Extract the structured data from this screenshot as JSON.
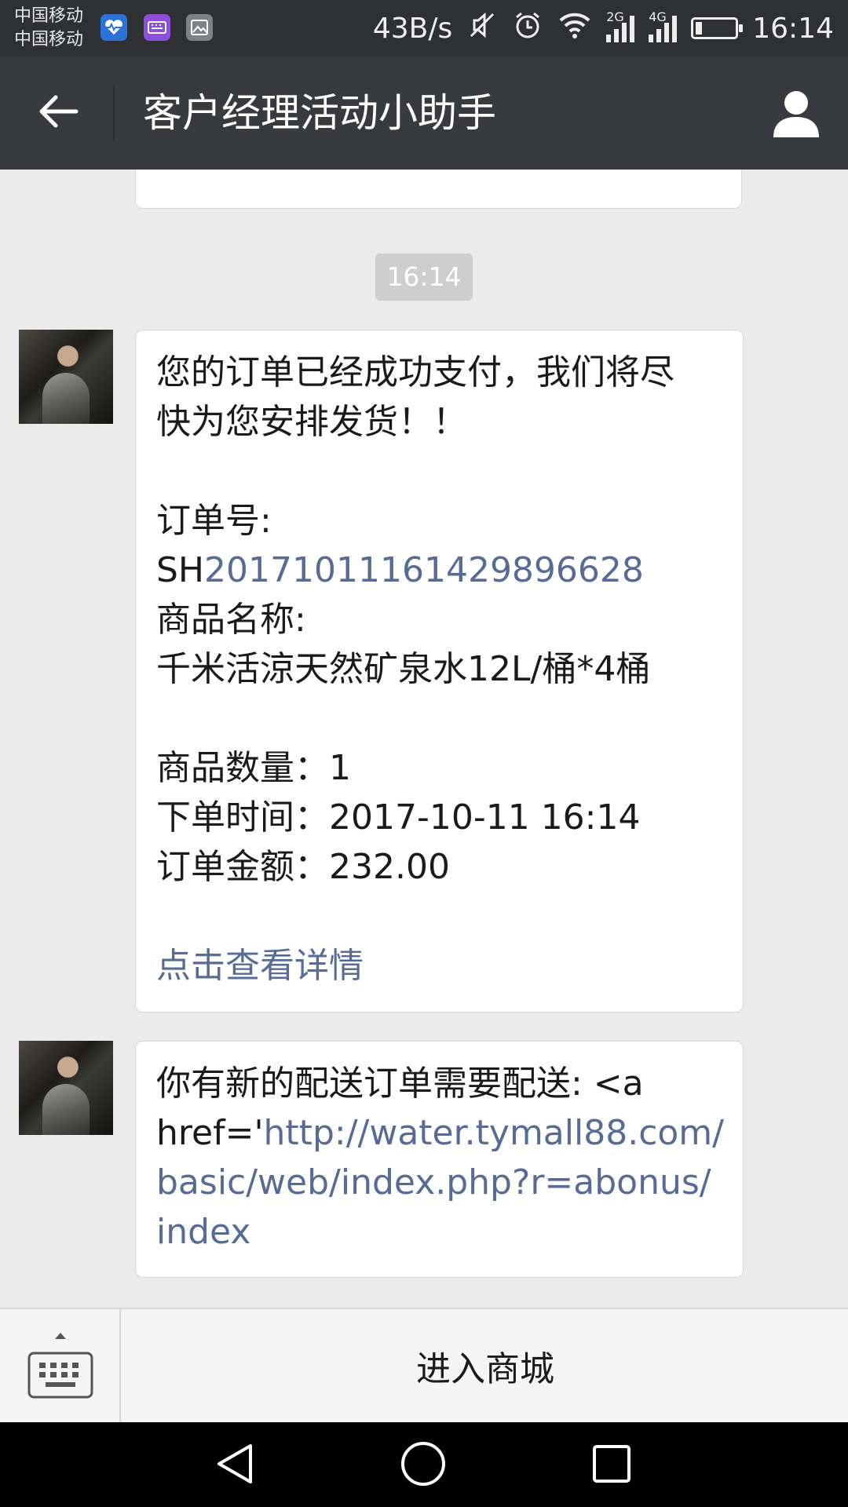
{
  "status_bar": {
    "carrier_1": "中国移动",
    "carrier_2": "中国移动",
    "net_speed": "43B/s",
    "signal_1_label": "2G",
    "signal_2_label": "4G",
    "time": "16:14",
    "icons": [
      "health-app-icon",
      "keyboard-app-icon",
      "gallery-app-icon",
      "mute-icon",
      "alarm-icon",
      "wifi-icon",
      "signal-icon",
      "battery-icon"
    ]
  },
  "header": {
    "title": "客户经理活动小助手",
    "back_icon": "arrow-left-icon",
    "profile_icon": "person-icon"
  },
  "chat": {
    "timestamp": "16:14",
    "message_1": {
      "line_1": "您的订单已经成功支付，我们将尽",
      "line_2": "快为您安排发货！！",
      "order_label": "订单号:",
      "order_prefix": "SH",
      "order_number": "20171011161429896628",
      "product_label": "商品名称:",
      "product_name": "千米活涼天然矿泉水12L/桶*4桶",
      "quantity": "商品数量：1",
      "order_time": "下单时间：2017-10-11 16:14",
      "order_amount": "订单金额：232.00",
      "details_link": "点击查看详情"
    },
    "message_2": {
      "line_1": "你有新的配送订单需要配送: <a",
      "line_2_prefix": "href='",
      "url_part_1": "http://water.tymall88.com/",
      "url_part_2": "basic/web/index.php?r=abonus/",
      "url_part_3": "index"
    }
  },
  "bottom_bar": {
    "keyboard_icon": "keyboard-icon",
    "menu_button": "进入商城"
  },
  "nav_bar": {
    "icons": [
      "nav-back-icon",
      "nav-home-icon",
      "nav-recent-icon"
    ]
  },
  "colors": {
    "title_bar": "#393a3f",
    "status_bar": "#2e3033",
    "chat_background": "#ebebeb",
    "link": "#576b95"
  }
}
